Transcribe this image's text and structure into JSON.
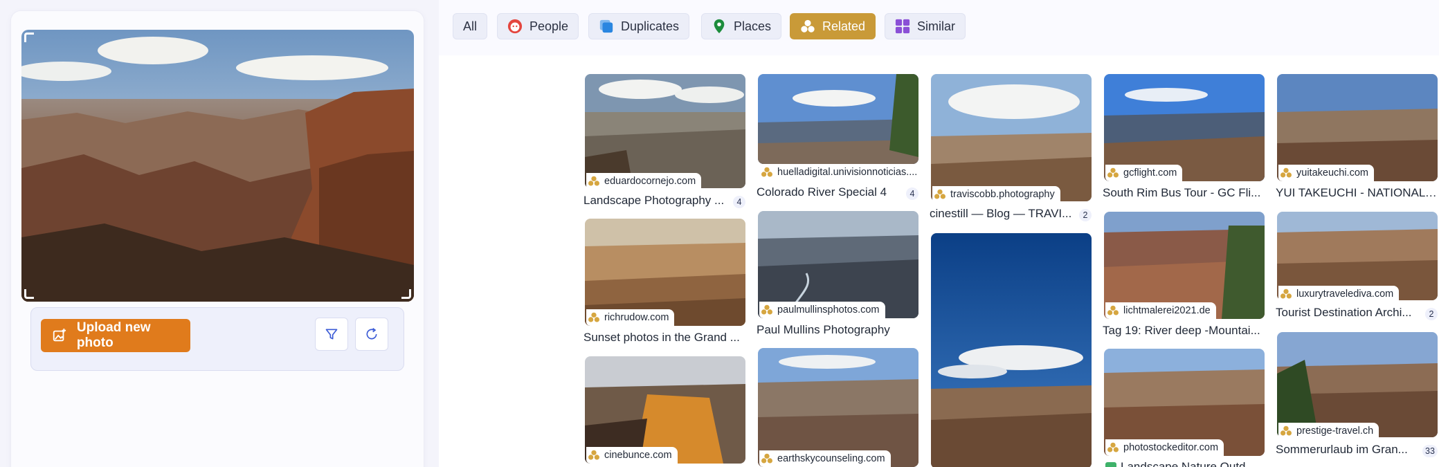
{
  "upload": {
    "label": "Upload new photo"
  },
  "filters": [
    {
      "label": "All",
      "icon": "none",
      "active": false
    },
    {
      "label": "People",
      "icon": "face-icon",
      "active": false
    },
    {
      "label": "Duplicates",
      "icon": "duplicates-icon",
      "active": false
    },
    {
      "label": "Places",
      "icon": "map-pin-icon",
      "active": false
    },
    {
      "label": "Related",
      "icon": "related-dots-icon",
      "active": true
    },
    {
      "label": "Similar",
      "icon": "grid-icon",
      "active": false
    }
  ],
  "results": [
    {
      "source": "eduardocornejo.com",
      "caption": "Landscape Photography ...",
      "count": "4"
    },
    {
      "source": "richrudow.com",
      "caption": "Sunset photos in the Grand ...",
      "count": ""
    },
    {
      "source": "cinebunce.com",
      "caption": "",
      "count": ""
    },
    {
      "source": "huelladigital.univisionnoticias....",
      "caption": "Colorado River Special 4",
      "count": "4"
    },
    {
      "source": "paulmullinsphotos.com",
      "caption": "Paul Mullins Photography",
      "count": ""
    },
    {
      "source": "earthskycounseling.com",
      "caption": "",
      "count": ""
    },
    {
      "source": "traviscobb.photography",
      "caption": "cinestill — Blog — TRAVI...",
      "count": "2"
    },
    {
      "source": "",
      "caption": "",
      "count": ""
    },
    {
      "source": "gcflight.com",
      "caption": "South Rim Bus Tour - GC Fli...",
      "count": ""
    },
    {
      "source": "lichtmalerei2021.de",
      "caption": "Tag 19: River deep -Mountai...",
      "count": ""
    },
    {
      "source": "photostockeditor.com",
      "caption": "Landscape Nature Outd...",
      "count": ""
    },
    {
      "source": "yuitakeuchi.com",
      "caption": "YUI TAKEUCHI - NATIONAL P...",
      "count": ""
    },
    {
      "source": "luxurytravelediva.com",
      "caption": "Tourist Destination Archi...",
      "count": "2"
    },
    {
      "source": "prestige-travel.ch",
      "caption": "Sommerurlaub im Gran...",
      "count": "33"
    }
  ],
  "colors": {
    "accent": "#e07b1c",
    "related_active": "#c99a38",
    "source_icon": "#d6a640"
  }
}
